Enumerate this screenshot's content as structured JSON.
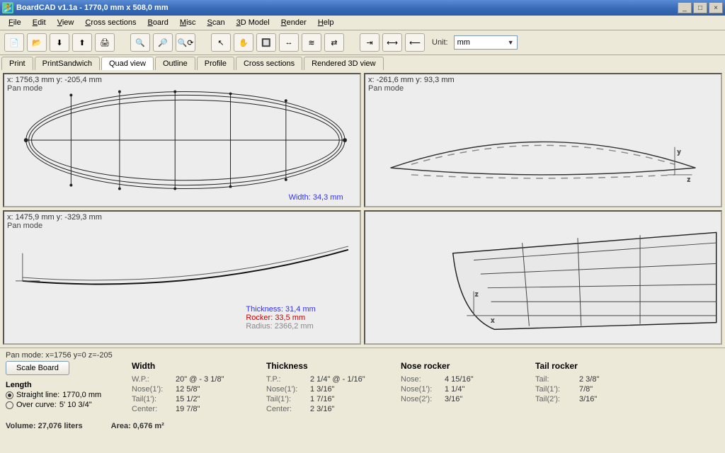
{
  "title": "BoardCAD v1.1a -   1770,0 mm x 508,0 mm",
  "menus": [
    "File",
    "Edit",
    "View",
    "Cross sections",
    "Board",
    "Misc",
    "Scan",
    "3D Model",
    "Render",
    "Help"
  ],
  "toolbar_icons": [
    "new",
    "open",
    "save-down",
    "save-up",
    "print",
    "zoom-in",
    "zoom-out",
    "zoom-reset",
    "pointer",
    "pan-hand",
    "zoom-box",
    "select",
    "cross-section",
    "mirror",
    "flip",
    "dim-a",
    "dim-b",
    "dim-c"
  ],
  "unit": {
    "label": "Unit:",
    "value": "mm"
  },
  "tabs": [
    "Print",
    "PrintSandwich",
    "Quad view",
    "Outline",
    "Profile",
    "Cross sections",
    "Rendered 3D view"
  ],
  "active_tab": 2,
  "panes": {
    "top_left": {
      "coords": "x: 1756,3 mm  y: -205,4 mm",
      "mode": "Pan mode",
      "width_label": "Width:  34,3 mm"
    },
    "top_right": {
      "coords": "x: -261,6 mm  y: 93,3 mm",
      "mode": "Pan mode"
    },
    "bottom_left": {
      "coords": "x: 1475,9 mm  y: -329,3 mm",
      "mode": "Pan mode",
      "thickness": "Thickness:   31,4 mm",
      "rocker": "Rocker: 33,5 mm",
      "radius": "Radius: 2366,2 mm"
    },
    "bottom_right": {
      "coords": ""
    }
  },
  "pan_status": "Pan mode: x=1756 y=0 z=-205",
  "scale_button": "Scale Board",
  "length_section": {
    "heading": "Length",
    "straight": {
      "label": "Straight line:",
      "value": "1770,0 mm"
    },
    "overcurve": {
      "label": "Over curve:",
      "value": "5' 10 3/4\""
    }
  },
  "width": {
    "heading": "Width",
    "wp": {
      "k": "W.P.:",
      "v": "20\" @ - 3 1/8\""
    },
    "nose": {
      "k": "Nose(1'):",
      "v": "12 5/8\""
    },
    "tail": {
      "k": "Tail(1'):",
      "v": "15 1/2\""
    },
    "center": {
      "k": "Center:",
      "v": "19 7/8\""
    }
  },
  "thickness": {
    "heading": "Thickness",
    "tp": {
      "k": "T.P.:",
      "v": "2 1/4\" @ - 1/16\""
    },
    "nose": {
      "k": "Nose(1'):",
      "v": "1 3/16\""
    },
    "tail": {
      "k": "Tail(1'):",
      "v": "1 7/16\""
    },
    "center": {
      "k": "Center:",
      "v": "2 3/16\""
    }
  },
  "nose_rocker": {
    "heading": "Nose rocker",
    "r0": {
      "k": "Nose:",
      "v": "4 15/16\""
    },
    "r1": {
      "k": "Nose(1'):",
      "v": "1 1/4\""
    },
    "r2": {
      "k": "Nose(2'):",
      "v": "3/16\""
    }
  },
  "tail_rocker": {
    "heading": "Tail rocker",
    "r0": {
      "k": "Tail:",
      "v": "2 3/8\""
    },
    "r1": {
      "k": "Tail(1'):",
      "v": "7/8\""
    },
    "r2": {
      "k": "Tail(2'):",
      "v": "3/16\""
    }
  },
  "footer": {
    "volume": "Volume: 27,076 liters",
    "area": "Area: 0,676 m²"
  }
}
